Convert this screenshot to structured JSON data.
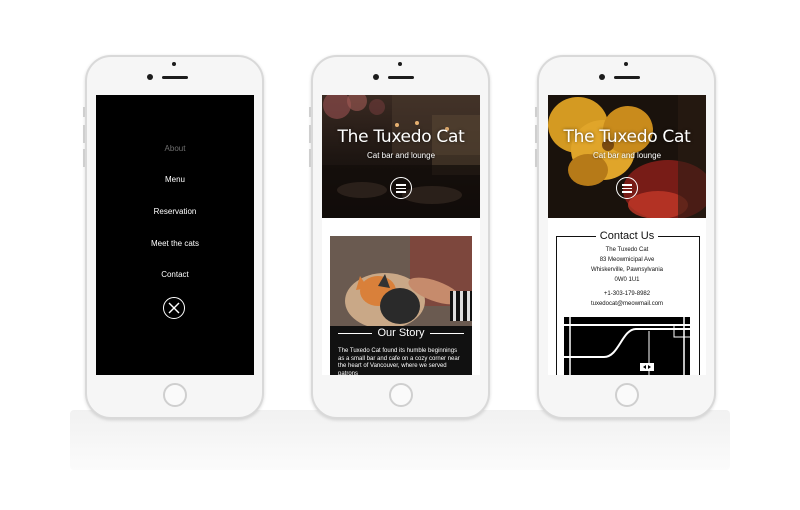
{
  "phone1": {
    "menu": [
      "About",
      "Menu",
      "Reservation",
      "Meet the cats",
      "Contact"
    ],
    "close_icon": "close-circle-icon"
  },
  "phone2": {
    "title": "The Tuxedo Cat",
    "subtitle": "Cat bar and lounge",
    "menu_icon": "hamburger-icon",
    "story": {
      "heading": "Our Story",
      "text": "The Tuxedo Cat found its humble beginnings as a small bar and cafe on a cozy corner near the heart of Vancouver, where we served patrons"
    }
  },
  "phone3": {
    "title": "The Tuxedo Cat",
    "subtitle": "Cat bar and lounge",
    "menu_icon": "hamburger-icon",
    "contact": {
      "heading": "Contact Us",
      "name": "The Tuxedo Cat",
      "address1": "83 Meowmicipal Ave",
      "address2": "Whiskerville, Pawnsylvania",
      "postal": "0W0 1U1",
      "phone": "+1-303-179-8982",
      "email": "tuxedocat@meowmail.com"
    }
  },
  "colors": {
    "background": "#ffffff",
    "device": "#f6f6f6",
    "screen_dark": "#000000",
    "text_light": "#ffffff",
    "text_dark": "#111111"
  }
}
